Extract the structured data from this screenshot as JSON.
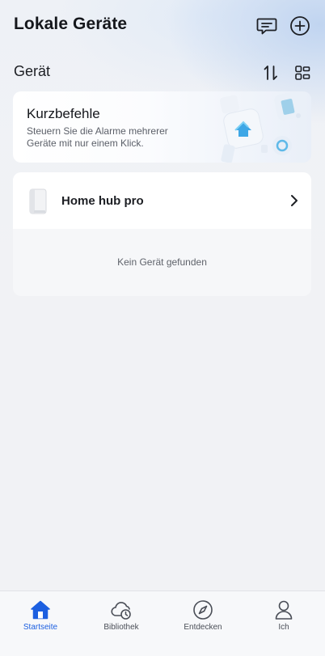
{
  "header": {
    "title": "Lokale Geräte"
  },
  "section": {
    "title": "Gerät"
  },
  "shortcut_card": {
    "title": "Kurzbefehle",
    "description": "Steuern Sie die Alarme mehrerer Geräte mit nur einem Klick."
  },
  "devices": {
    "items": [
      {
        "name": "Home hub pro"
      }
    ],
    "empty_text": "Kein Gerät gefunden"
  },
  "tabbar": {
    "tabs": [
      {
        "label": "Startseite",
        "icon": "home-icon",
        "active": true
      },
      {
        "label": "Bibliothek",
        "icon": "cloud-clock-icon",
        "active": false
      },
      {
        "label": "Entdecken",
        "icon": "compass-icon",
        "active": false
      },
      {
        "label": "Ich",
        "icon": "person-icon",
        "active": false
      }
    ]
  },
  "colors": {
    "accent": "#1c5fe0",
    "text": "#1d1f24",
    "background": "#f1f2f5"
  }
}
